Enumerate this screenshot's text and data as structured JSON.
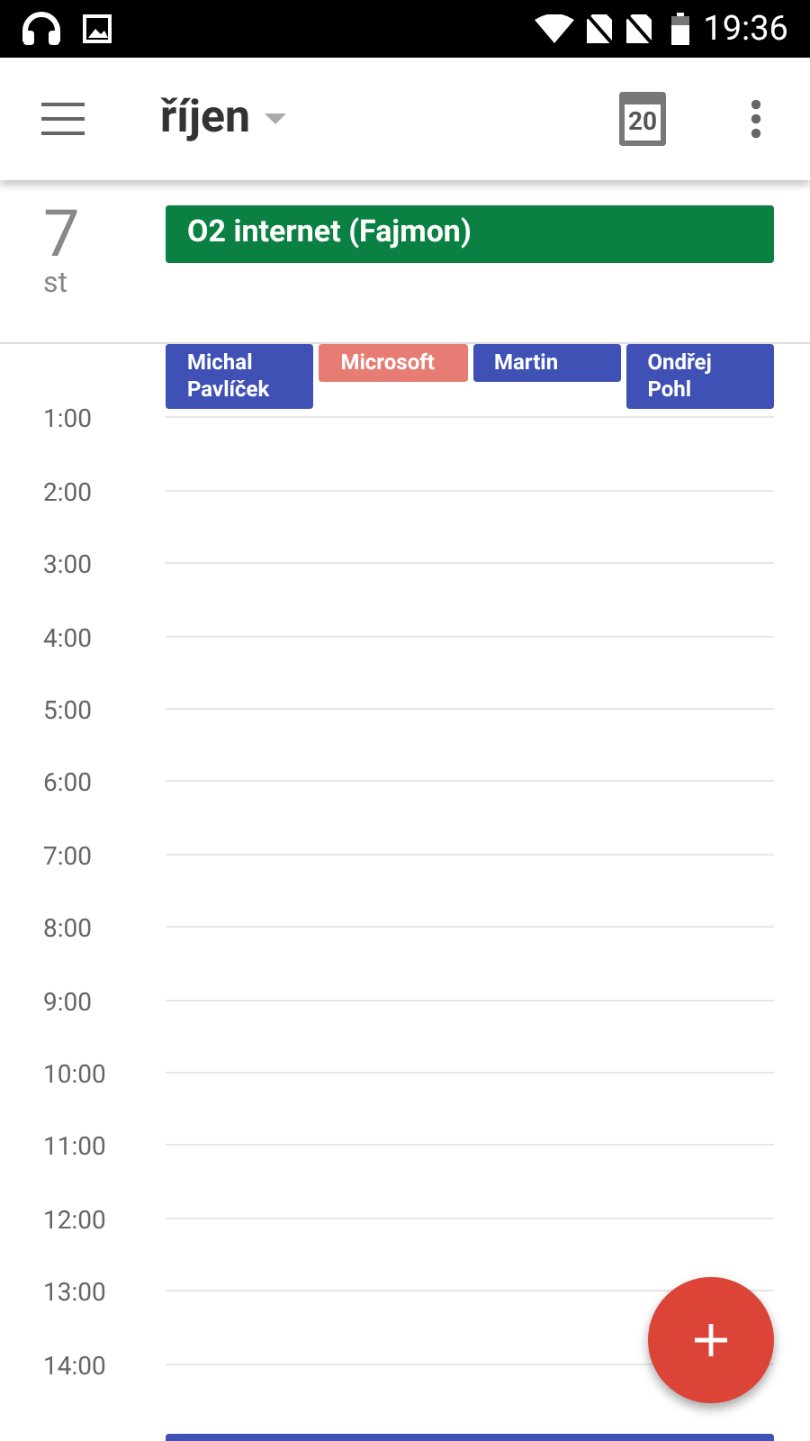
{
  "status_bar": {
    "time": "19:36"
  },
  "app_bar": {
    "title": "říjen"
  },
  "today_icon": {
    "day": "20"
  },
  "day": {
    "number": "7",
    "weekday": "st"
  },
  "all_day_events": [
    {
      "title": "O2 internet (Fajmon)",
      "color": "#0b8043"
    }
  ],
  "events": [
    {
      "title": "Michal Pavlíček",
      "color": "#3f51b5"
    },
    {
      "title": "Microsoft",
      "color": "#e67c73"
    },
    {
      "title": "Martin",
      "color": "#3f51b5"
    },
    {
      "title": "Ondřej Pohl",
      "color": "#3f51b5"
    }
  ],
  "hours": [
    "1:00",
    "2:00",
    "3:00",
    "4:00",
    "5:00",
    "6:00",
    "7:00",
    "8:00",
    "9:00",
    "10:00",
    "11:00",
    "12:00",
    "13:00",
    "14:00"
  ],
  "later_events": [
    {
      "color": "#3f51b5"
    }
  ]
}
